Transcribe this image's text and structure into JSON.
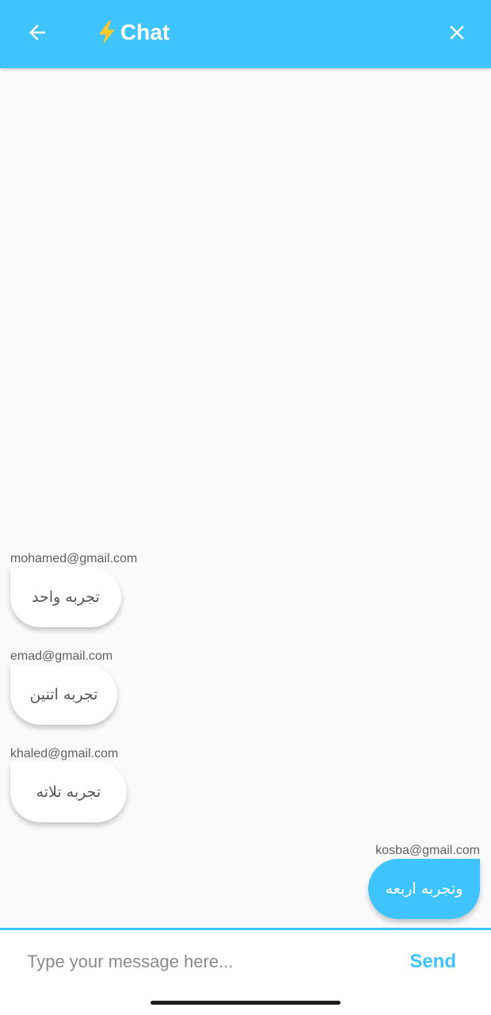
{
  "colors": {
    "accent": "#40c4ff",
    "background": "#fafafa",
    "bubble_other": "#ffffff",
    "text_secondary": "#5f5f5f"
  },
  "header": {
    "title": "Chat",
    "back_icon": "arrow-left-icon",
    "title_icon": "lightning-bolt-icon",
    "close_icon": "close-icon"
  },
  "messages": [
    {
      "sender": "mohamed@gmail.com",
      "text": "تجربه واحد",
      "mine": false
    },
    {
      "sender": "emad@gmail.com",
      "text": "تجربه اتنين",
      "mine": false
    },
    {
      "sender": "khaled@gmail.com",
      "text": "تجربه تلاته",
      "mine": false
    },
    {
      "sender": "kosba@gmail.com",
      "text": "وتجربه اربعه",
      "mine": true
    }
  ],
  "composer": {
    "placeholder": "Type your message here...",
    "value": "",
    "send_label": "Send"
  }
}
